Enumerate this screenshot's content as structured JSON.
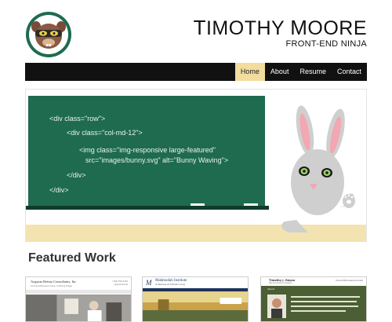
{
  "header": {
    "name_first_letter": "T",
    "name_rest_first": "imothy ",
    "name_last_letter": "M",
    "name_rest_last": "oore",
    "role": "Front-End Ninja"
  },
  "nav": {
    "items": [
      {
        "label": "Home",
        "active": true
      },
      {
        "label": "About",
        "active": false
      },
      {
        "label": "Resume",
        "active": false
      },
      {
        "label": "Contact",
        "active": false
      }
    ]
  },
  "hero": {
    "code_lines": [
      "<div class=\"row\">",
      "<div class=\"col-md-12\">",
      "<img class=\"img-responsive large-featured\"",
      "src=\"images/bunny.svg\" alt=\"Bunny Waving\">",
      "</div>",
      "</div>"
    ],
    "colors": {
      "chalkboard": "#1f6b4f",
      "chalkboard_frame": "#0f3d2d",
      "chalk_text": "#eaf2ec",
      "bunny": "#cfcfcf",
      "bunny_ear_inner": "#f2a7b2",
      "floor": "#f3e3b0"
    }
  },
  "featured": {
    "title": "Featured Work",
    "thumbs": [
      {
        "title": "Augusta Retina Consultants, Inc",
        "subtitle": "Comprehensive Care, Cutting Edge",
        "phone_line1": "(706) 555-0100",
        "phone_line2": "Appointments"
      },
      {
        "mark": "M",
        "title": "Mahmudah Institute",
        "subtitle": "of Wellness and Mindful Living"
      },
      {
        "title": "Timothy J. Repco",
        "subtitle": "Web Developer & Designer",
        "menu": "Home  Portfolio  Resume  Contact",
        "about": "About"
      }
    ]
  }
}
